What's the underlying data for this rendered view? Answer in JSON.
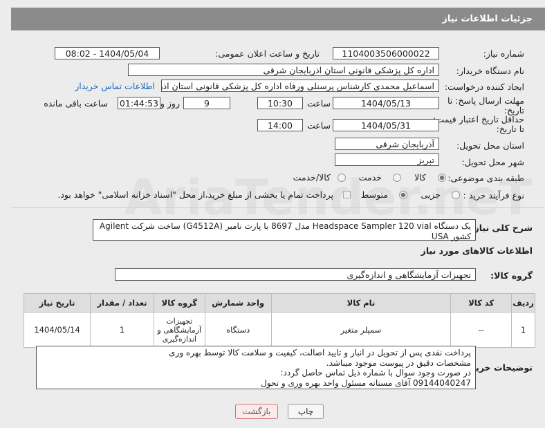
{
  "header": {
    "title": "جزئیات اطلاعات نیاز"
  },
  "fields": {
    "need_number_label": "شماره نیاز:",
    "need_number": "1104003506000022",
    "announce_label": "تاریخ و ساعت اعلان عمومی:",
    "announce_value": "1404/05/04 - 08:02",
    "buyer_org_label": "نام دستگاه خریدار:",
    "buyer_org": "اداره کل پزشکی قانونی استان اذربایجان شرقی",
    "requester_label": "ایجاد کننده درخواست:",
    "requester": "اسماعیل محمدی کارشناس پرسنلی ورفاه اداره کل پزشکی قانونی استان اذربای",
    "contact_link": "اطلاعات تماس خریدار",
    "deadline_label_1": "مهلت ارسال پاسخ: تا",
    "deadline_label_2": "تاریخ:",
    "deadline_date": "1404/05/13",
    "time_label": "ساعت",
    "deadline_time": "10:30",
    "days_value": "9",
    "days_label": "روز و",
    "remaining_time": "01:44:53",
    "remaining_label": "ساعت باقی مانده",
    "price_validity_label_1": "حداقل تاریخ اعتبار قیمت:",
    "price_validity_label_2": "تا تاریخ:",
    "price_validity_date": "1404/05/31",
    "price_validity_time": "14:00",
    "province_label": "استان محل تحویل:",
    "province": "آذربایجان شرقی",
    "city_label": "شهر محل تحویل:",
    "city": "تبریز",
    "category_label": "طبقه بندی موضوعی:",
    "category_options": [
      "کالا",
      "خدمت",
      "کالا/خدمت"
    ],
    "process_label": "نوع فرآیند خرید :",
    "process_options": [
      "جزیی",
      "متوسط"
    ],
    "payment_note": "پرداخت تمام یا بخشی از مبلغ خرید،از محل \"اسناد خزانه اسلامی\" خواهد بود."
  },
  "summary": {
    "label": "شرح کلی نیاز:",
    "text": "یک دستگاه Headspace Sampler 120 vial مدل 8697 با پارت نامبر (G4512A) ساخت شرکت Agilent کشور USA"
  },
  "goods_info_title": "اطلاعات کالاهای مورد نیاز",
  "goods_group": {
    "label": "گروه کالا:",
    "value": "تجهیزات آزمایشگاهی و اندازه‌گیری"
  },
  "table": {
    "headers": [
      "ردیف",
      "کد کالا",
      "نام کالا",
      "واحد شمارش",
      "گروه کالا",
      "تعداد / مقدار",
      "تاریخ نیاز"
    ],
    "rows": [
      {
        "row": "1",
        "code": "--",
        "name": "سمپلر متغیر",
        "unit": "دستگاه",
        "group": [
          "تجهیزات",
          "آزمایشگاهی و",
          "اندازه‌گیری"
        ],
        "qty": "1",
        "date": "1404/05/14"
      }
    ]
  },
  "buyer_notes": {
    "label": "توضیحات خریدار:",
    "lines": [
      "پرداخت نقدی پس از تحویل در انبار و تایید اصالت، کیفیت و سلامت کالا توسط بهره وری",
      "مشخصات دقیق در پیوست موجود میباشد.",
      "در صورت وجود سوال با شماره ذیل تماس حاصل گردد:",
      "09144040247 آقای مستانه مسئول واحد بهره وری و تحول"
    ]
  },
  "buttons": {
    "print": "چاپ",
    "back": "بازگشت"
  },
  "watermark": "AriaTender.neT"
}
